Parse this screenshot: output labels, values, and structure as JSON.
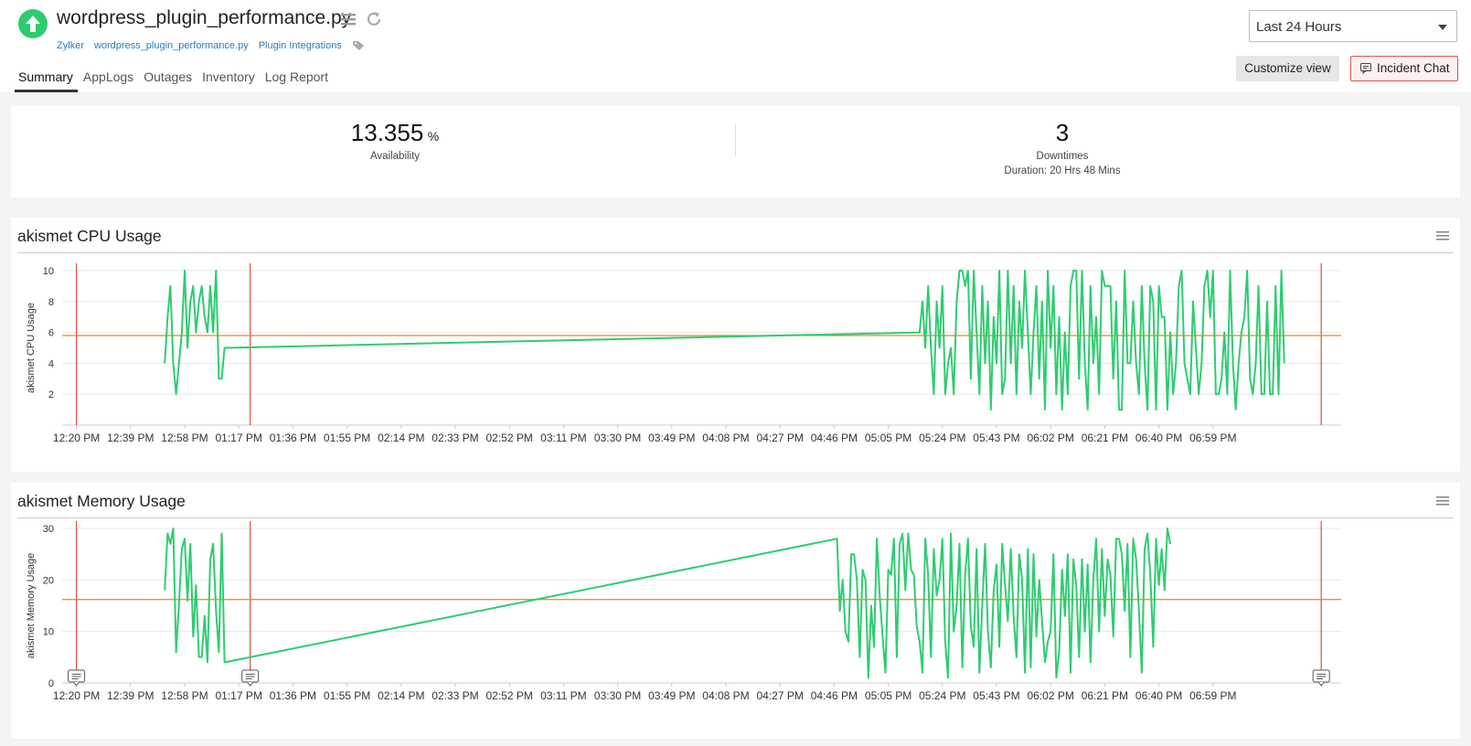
{
  "header": {
    "title": "wordpress_plugin_performance.py",
    "links": [
      "Zylker",
      "wordpress_plugin_performance.py",
      "Plugin Integrations"
    ],
    "tabs": [
      "Summary",
      "AppLogs",
      "Outages",
      "Inventory",
      "Log Report"
    ],
    "active_tab": "Summary",
    "time_range": "Last 24 Hours",
    "customize_label": "Customize view",
    "incident_chat_label": "Incident Chat",
    "status_color": "#2ecc71"
  },
  "stats": {
    "availability_value": "13.355",
    "availability_unit": "%",
    "availability_label": "Availability",
    "downtimes_value": "3",
    "downtimes_label": "Downtimes",
    "duration_text": "Duration: 20 Hrs 48 Mins"
  },
  "chart_data": [
    {
      "type": "line",
      "title": "akismet CPU Usage",
      "ylabel": "akismet CPU Usage",
      "xlabel": "",
      "ylim": [
        0,
        10
      ],
      "yticks": [
        2,
        4,
        6,
        8,
        10
      ],
      "x_ticks": [
        "12:20 PM",
        "12:39 PM",
        "12:58 PM",
        "01:17 PM",
        "01:36 PM",
        "01:55 PM",
        "02:14 PM",
        "02:33 PM",
        "02:52 PM",
        "03:11 PM",
        "03:30 PM",
        "03:49 PM",
        "04:08 PM",
        "04:27 PM",
        "04:46 PM",
        "05:05 PM",
        "05:24 PM",
        "05:43 PM",
        "06:02 PM",
        "06:21 PM",
        "06:40 PM",
        "06:59 PM"
      ],
      "x_range_minutes": [
        -5,
        444
      ],
      "average": 5.8,
      "marker_lines_minutes": [
        0,
        61,
        437
      ],
      "series_color": "#2ecc71",
      "average_color": "#e08a2c",
      "marker_color": "#e74c3c",
      "grid": true,
      "data": [
        [
          31,
          4
        ],
        [
          32,
          7
        ],
        [
          33,
          9
        ],
        [
          34,
          4
        ],
        [
          35,
          2
        ],
        [
          37,
          6
        ],
        [
          38,
          10
        ],
        [
          39,
          5
        ],
        [
          40,
          8
        ],
        [
          41,
          9
        ],
        [
          42,
          6
        ],
        [
          43,
          8
        ],
        [
          44,
          9
        ],
        [
          45,
          7
        ],
        [
          46,
          6
        ],
        [
          47,
          9
        ],
        [
          48,
          6
        ],
        [
          49,
          10
        ],
        [
          50,
          3
        ],
        [
          51,
          3
        ],
        [
          52,
          5
        ],
        [
          296,
          6
        ],
        [
          297,
          8
        ],
        [
          298,
          5
        ],
        [
          299,
          9
        ],
        [
          300,
          5
        ],
        [
          301,
          2
        ],
        [
          302,
          8
        ],
        [
          303,
          5
        ],
        [
          304,
          9
        ],
        [
          305,
          2
        ],
        [
          306,
          4
        ],
        [
          307,
          5
        ],
        [
          308,
          2
        ],
        [
          309,
          8
        ],
        [
          310,
          10
        ],
        [
          311,
          10
        ],
        [
          312,
          9
        ],
        [
          313,
          10
        ],
        [
          314,
          3
        ],
        [
          315,
          10
        ],
        [
          316,
          6
        ],
        [
          317,
          2
        ],
        [
          318,
          9
        ],
        [
          319,
          4
        ],
        [
          320,
          8
        ],
        [
          321,
          1
        ],
        [
          322,
          7
        ],
        [
          323,
          4
        ],
        [
          324,
          10
        ],
        [
          325,
          2
        ],
        [
          326,
          3
        ],
        [
          327,
          10
        ],
        [
          328,
          4
        ],
        [
          329,
          9
        ],
        [
          330,
          2
        ],
        [
          331,
          8
        ],
        [
          332,
          5
        ],
        [
          333,
          10
        ],
        [
          334,
          6
        ],
        [
          335,
          2
        ],
        [
          336,
          6
        ],
        [
          337,
          9
        ],
        [
          338,
          3
        ],
        [
          339,
          8
        ],
        [
          340,
          1
        ],
        [
          341,
          10
        ],
        [
          342,
          5
        ],
        [
          343,
          9
        ],
        [
          344,
          2
        ],
        [
          345,
          7
        ],
        [
          346,
          1
        ],
        [
          347,
          6
        ],
        [
          348,
          2
        ],
        [
          349,
          9
        ],
        [
          350,
          10
        ],
        [
          351,
          10
        ],
        [
          352,
          3
        ],
        [
          353,
          10
        ],
        [
          354,
          4
        ],
        [
          355,
          1
        ],
        [
          356,
          9
        ],
        [
          357,
          4
        ],
        [
          358,
          7
        ],
        [
          359,
          2
        ],
        [
          360,
          10
        ],
        [
          361,
          9
        ],
        [
          362,
          9
        ],
        [
          363,
          9
        ],
        [
          364,
          3
        ],
        [
          365,
          8
        ],
        [
          366,
          1
        ],
        [
          367,
          1
        ],
        [
          368,
          10
        ],
        [
          369,
          4
        ],
        [
          370,
          4
        ],
        [
          371,
          8
        ],
        [
          372,
          4
        ],
        [
          373,
          2
        ],
        [
          374,
          9
        ],
        [
          375,
          4
        ],
        [
          376,
          1
        ],
        [
          377,
          9
        ],
        [
          378,
          8
        ],
        [
          379,
          1
        ],
        [
          380,
          9
        ],
        [
          381,
          7
        ],
        [
          382,
          7
        ],
        [
          383,
          1
        ],
        [
          384,
          6
        ],
        [
          385,
          2
        ],
        [
          386,
          4
        ],
        [
          387,
          9
        ],
        [
          388,
          10
        ],
        [
          389,
          4
        ],
        [
          390,
          3
        ],
        [
          391,
          2
        ],
        [
          392,
          8
        ],
        [
          393,
          5
        ],
        [
          394,
          2
        ],
        [
          395,
          4
        ],
        [
          396,
          9
        ],
        [
          397,
          10
        ],
        [
          398,
          7
        ],
        [
          399,
          10
        ],
        [
          400,
          2
        ],
        [
          401,
          2
        ],
        [
          402,
          3
        ],
        [
          403,
          6
        ],
        [
          404,
          2
        ],
        [
          405,
          10
        ],
        [
          406,
          4
        ],
        [
          407,
          1
        ],
        [
          408,
          4
        ],
        [
          409,
          6
        ],
        [
          410,
          7
        ],
        [
          411,
          10
        ],
        [
          412,
          3
        ],
        [
          413,
          2
        ],
        [
          414,
          4
        ],
        [
          415,
          9
        ],
        [
          416,
          2
        ],
        [
          417,
          2
        ],
        [
          418,
          8
        ],
        [
          419,
          2
        ],
        [
          420,
          2
        ],
        [
          421,
          9
        ],
        [
          422,
          2
        ],
        [
          423,
          10
        ],
        [
          424,
          4
        ]
      ]
    },
    {
      "type": "line",
      "title": "akismet Memory Usage",
      "ylabel": "akismet Memory Usage",
      "xlabel": "",
      "ylim": [
        0,
        30
      ],
      "yticks": [
        0,
        10,
        20,
        30
      ],
      "x_ticks": [
        "12:20 PM",
        "12:39 PM",
        "12:58 PM",
        "01:17 PM",
        "01:36 PM",
        "01:55 PM",
        "02:14 PM",
        "02:33 PM",
        "02:52 PM",
        "03:11 PM",
        "03:30 PM",
        "03:49 PM",
        "04:08 PM",
        "04:27 PM",
        "04:46 PM",
        "05:05 PM",
        "05:24 PM",
        "05:43 PM",
        "06:02 PM",
        "06:21 PM",
        "06:40 PM",
        "06:59 PM"
      ],
      "x_range_minutes": [
        -5,
        444
      ],
      "average": 16.2,
      "marker_lines_minutes": [
        0,
        61,
        437
      ],
      "series_color": "#2ecc71",
      "average_color": "#e08a2c",
      "marker_color": "#e74c3c",
      "grid": true,
      "data": [
        [
          31,
          18
        ],
        [
          32,
          29
        ],
        [
          33,
          27
        ],
        [
          34,
          30
        ],
        [
          35,
          6
        ],
        [
          36,
          15
        ],
        [
          37,
          26
        ],
        [
          38,
          28
        ],
        [
          39,
          16
        ],
        [
          40,
          27
        ],
        [
          41,
          9
        ],
        [
          42,
          19
        ],
        [
          43,
          5
        ],
        [
          44,
          5
        ],
        [
          45,
          13
        ],
        [
          46,
          4
        ],
        [
          47,
          24
        ],
        [
          48,
          27
        ],
        [
          49,
          14
        ],
        [
          50,
          6
        ],
        [
          51,
          29
        ],
        [
          52,
          4
        ],
        [
          267,
          28
        ],
        [
          268,
          14
        ],
        [
          269,
          20
        ],
        [
          270,
          10
        ],
        [
          271,
          8
        ],
        [
          272,
          25
        ],
        [
          273,
          25
        ],
        [
          274,
          20
        ],
        [
          275,
          5
        ],
        [
          276,
          22
        ],
        [
          277,
          20
        ],
        [
          278,
          1
        ],
        [
          279,
          15
        ],
        [
          280,
          7
        ],
        [
          281,
          28
        ],
        [
          282,
          17
        ],
        [
          283,
          9
        ],
        [
          284,
          2
        ],
        [
          285,
          22
        ],
        [
          286,
          21
        ],
        [
          287,
          28
        ],
        [
          288,
          5
        ],
        [
          289,
          27
        ],
        [
          290,
          29
        ],
        [
          291,
          18
        ],
        [
          292,
          29
        ],
        [
          293,
          22
        ],
        [
          294,
          21
        ],
        [
          295,
          11
        ],
        [
          296,
          8
        ],
        [
          297,
          2
        ],
        [
          298,
          28
        ],
        [
          299,
          21
        ],
        [
          300,
          5
        ],
        [
          301,
          26
        ],
        [
          302,
          17
        ],
        [
          303,
          20
        ],
        [
          304,
          28
        ],
        [
          305,
          8
        ],
        [
          306,
          1
        ],
        [
          307,
          29
        ],
        [
          308,
          10
        ],
        [
          309,
          15
        ],
        [
          310,
          27
        ],
        [
          311,
          3
        ],
        [
          312,
          21
        ],
        [
          313,
          28
        ],
        [
          314,
          11
        ],
        [
          315,
          7
        ],
        [
          316,
          26
        ],
        [
          317,
          2
        ],
        [
          318,
          15
        ],
        [
          319,
          27
        ],
        [
          320,
          10
        ],
        [
          321,
          3
        ],
        [
          322,
          18
        ],
        [
          323,
          23
        ],
        [
          324,
          7
        ],
        [
          325,
          27
        ],
        [
          326,
          19
        ],
        [
          327,
          12
        ],
        [
          328,
          26
        ],
        [
          329,
          13
        ],
        [
          330,
          5
        ],
        [
          331,
          25
        ],
        [
          332,
          20
        ],
        [
          333,
          2
        ],
        [
          334,
          26
        ],
        [
          335,
          3
        ],
        [
          336,
          25
        ],
        [
          337,
          9
        ],
        [
          338,
          20
        ],
        [
          339,
          12
        ],
        [
          340,
          4
        ],
        [
          341,
          8
        ],
        [
          342,
          10
        ],
        [
          343,
          25
        ],
        [
          344,
          1
        ],
        [
          345,
          6
        ],
        [
          346,
          22
        ],
        [
          347,
          13
        ],
        [
          348,
          25
        ],
        [
          349,
          2
        ],
        [
          350,
          24
        ],
        [
          351,
          19
        ],
        [
          352,
          5
        ],
        [
          353,
          24
        ],
        [
          354,
          10
        ],
        [
          355,
          23
        ],
        [
          356,
          4
        ],
        [
          357,
          20
        ],
        [
          358,
          28
        ],
        [
          359,
          10
        ],
        [
          360,
          26
        ],
        [
          361,
          13
        ],
        [
          362,
          24
        ],
        [
          363,
          21
        ],
        [
          364,
          9
        ],
        [
          365,
          28
        ],
        [
          366,
          28
        ],
        [
          367,
          25
        ],
        [
          368,
          14
        ],
        [
          369,
          27
        ],
        [
          370,
          5
        ],
        [
          371,
          28
        ],
        [
          372,
          24
        ],
        [
          373,
          14
        ],
        [
          374,
          2
        ],
        [
          375,
          26
        ],
        [
          376,
          29
        ],
        [
          377,
          21
        ],
        [
          378,
          7
        ],
        [
          379,
          28
        ],
        [
          380,
          19
        ],
        [
          381,
          26
        ],
        [
          382,
          18
        ],
        [
          383,
          30
        ],
        [
          384,
          27
        ]
      ]
    }
  ]
}
